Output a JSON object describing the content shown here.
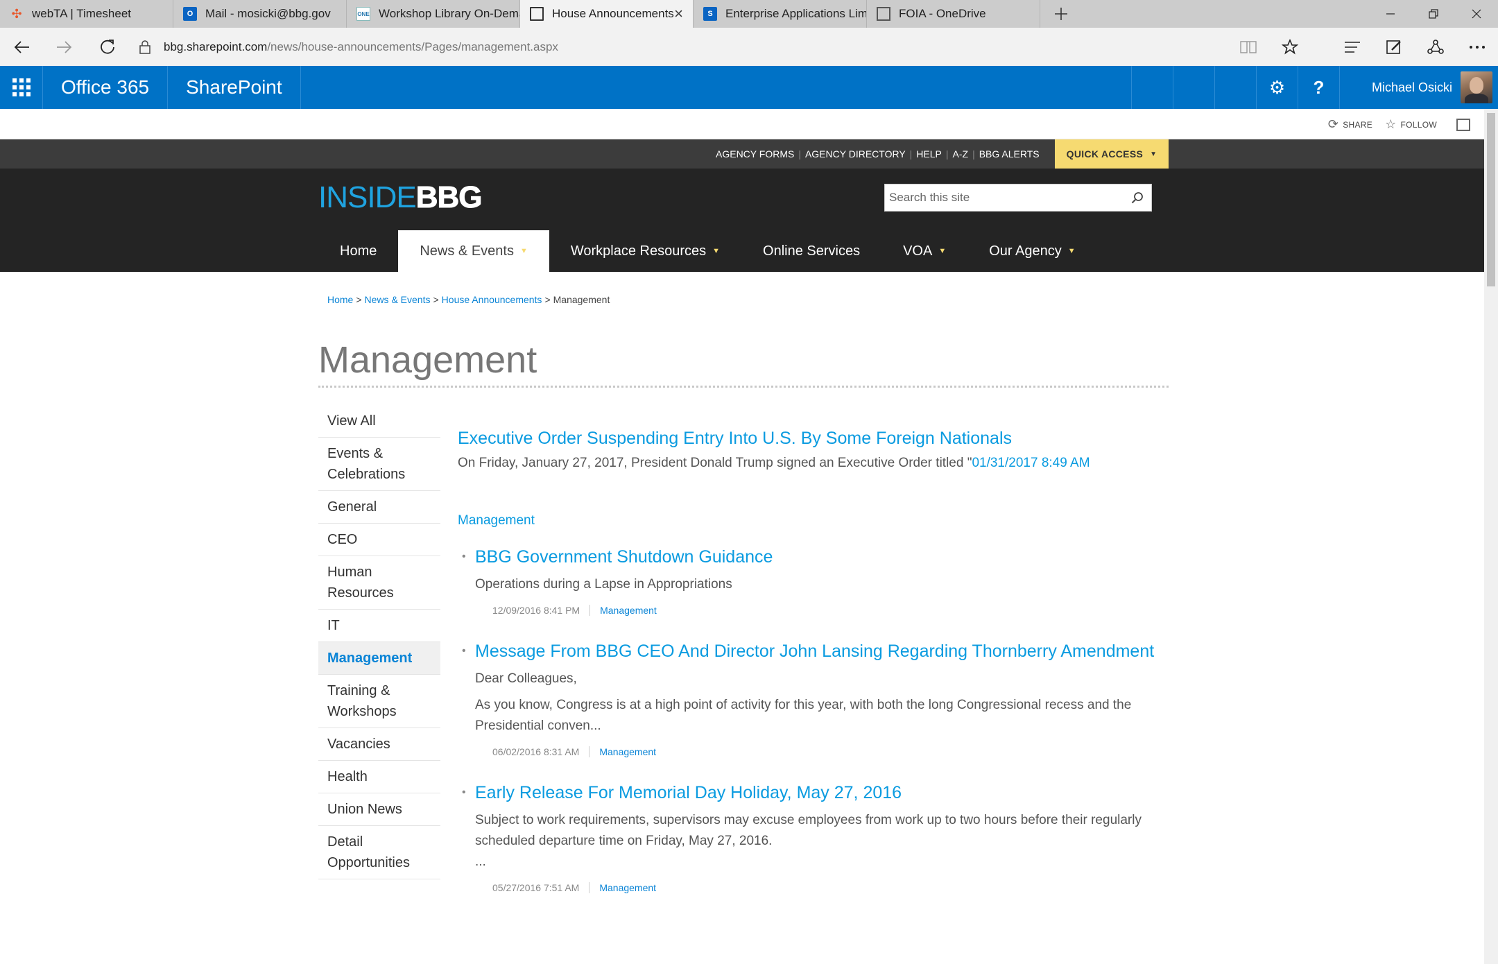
{
  "browser": {
    "tabs": [
      {
        "title": "webTA | Timesheet",
        "icon": "webta-icon"
      },
      {
        "title": "Mail - mosicki@bbg.gov",
        "icon": "outlook-icon"
      },
      {
        "title": "Workshop Library On-Dema",
        "icon": "workshop-icon"
      },
      {
        "title": "House Announcements",
        "icon": "page-icon",
        "active": true
      },
      {
        "title": "Enterprise Applications Limi",
        "icon": "sharepoint-icon"
      },
      {
        "title": "FOIA - OneDrive",
        "icon": "page-icon"
      }
    ],
    "url_host": "bbg.sharepoint.com",
    "url_path": "/news/house-announcements/Pages/management.aspx",
    "favicon_letters": {
      "mail": "O",
      "enterprise": "S",
      "workshop": "ONE"
    }
  },
  "suitebar": {
    "office": "Office 365",
    "app": "SharePoint",
    "settings_glyph": "⚙",
    "help_glyph": "?",
    "user_name": "Michael Osicki"
  },
  "actions": {
    "share": "SHARE",
    "follow": "FOLLOW"
  },
  "utility": {
    "links": [
      "AGENCY FORMS",
      "AGENCY DIRECTORY",
      "HELP",
      "A-Z",
      "BBG ALERTS"
    ],
    "quick_access": "QUICK ACCESS"
  },
  "site": {
    "logo_inside": "INSIDE",
    "logo_bbg": "BBG",
    "search_placeholder": "Search this site",
    "nav": [
      {
        "label": "Home",
        "dropdown": false
      },
      {
        "label": "News & Events",
        "dropdown": true,
        "selected": true
      },
      {
        "label": "Workplace Resources",
        "dropdown": true
      },
      {
        "label": "Online Services",
        "dropdown": false
      },
      {
        "label": "VOA",
        "dropdown": true
      },
      {
        "label": "Our Agency",
        "dropdown": true
      }
    ]
  },
  "breadcrumb": {
    "links": [
      "Home",
      "News & Events",
      "House Announcements"
    ],
    "current": "Management",
    "separator": ">"
  },
  "page": {
    "title": "Management",
    "leftnav": [
      "View All",
      "Events & Celebrations",
      "General",
      "CEO",
      "Human Resources",
      "IT",
      "Management",
      "Training & Workshops",
      "Vacancies",
      "Health",
      "Union News",
      "Detail Opportunities"
    ],
    "leftnav_selected": "Management",
    "featured": {
      "title": "Executive Order Suspending Entry Into U.S. By Some Foreign Nationals",
      "desc": "On Friday, January 27, 2017, President Donald Trump signed an Executive Order titled \"",
      "date": "01/31/2017 8:49 AM"
    },
    "section_label": "Management",
    "articles": [
      {
        "title": "BBG Government Shutdown Guidance",
        "body": [
          "Operations during a Lapse in Appropriations"
        ],
        "date": "12/09/2016 8:41 PM",
        "category": "Management"
      },
      {
        "title": "Message From BBG CEO And Director John Lansing Regarding Thornberry Amendment",
        "body": [
          "Dear Colleagues,",
          "As you know, Congress is at a high point of activity for this year, with both the long Congressional recess and the Presidential conven..."
        ],
        "date": "06/02/2016 8:31 AM",
        "category": "Management"
      },
      {
        "title": "Early Release For Memorial Day Holiday, May 27, 2016",
        "body": [
          "Subject to work requirements, supervisors may excuse employees from work up to two hours before their regularly scheduled departure time on Friday, May 27, 2016.",
          "..."
        ],
        "date": "05/27/2016 7:51 AM",
        "category": "Management"
      }
    ]
  },
  "colors": {
    "suite_blue": "#0072c6",
    "link_blue": "#0a9be0",
    "quick_access_yellow": "#f6da71",
    "header_dark": "#242424"
  }
}
